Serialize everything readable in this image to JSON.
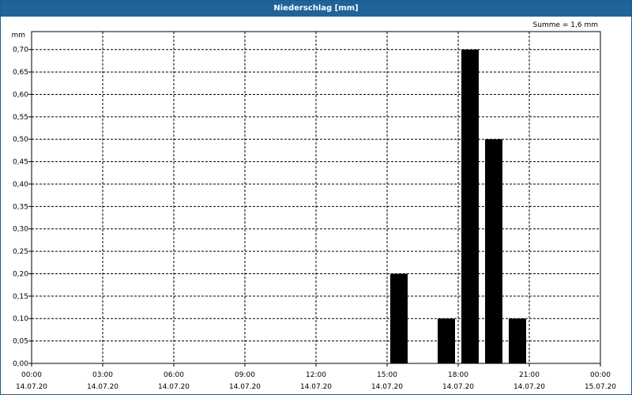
{
  "window": {
    "title": "Niederschlag [mm]"
  },
  "chart_data": {
    "type": "bar",
    "title": "Niederschlag [mm]",
    "annotation": "Summe = 1,6 mm",
    "ylabel": "mm",
    "xlabel": "",
    "ylim": [
      0,
      0.74
    ],
    "grid": true,
    "y_ticks": [
      "0,00",
      "0,05",
      "0,10",
      "0,15",
      "0,20",
      "0,25",
      "0,30",
      "0,35",
      "0,40",
      "0,45",
      "0,50",
      "0,55",
      "0,60",
      "0,65",
      "0,70"
    ],
    "x_ticks": [
      {
        "time": "00:00",
        "date": "14.07.20"
      },
      {
        "time": "03:00",
        "date": "14.07.20"
      },
      {
        "time": "06:00",
        "date": "14.07.20"
      },
      {
        "time": "09:00",
        "date": "14.07.20"
      },
      {
        "time": "12:00",
        "date": "14.07.20"
      },
      {
        "time": "15:00",
        "date": "14.07.20"
      },
      {
        "time": "18:00",
        "date": "14.07.20"
      },
      {
        "time": "21:00",
        "date": "14.07.20"
      },
      {
        "time": "00:00",
        "date": "15.07.20"
      }
    ],
    "bars": [
      {
        "start": "14.07.20 15:00",
        "end": "14.07.20 16:00",
        "value": 0.2
      },
      {
        "start": "14.07.20 17:00",
        "end": "14.07.20 18:00",
        "value": 0.1
      },
      {
        "start": "14.07.20 18:00",
        "end": "14.07.20 19:00",
        "value": 0.7
      },
      {
        "start": "14.07.20 19:00",
        "end": "14.07.20 20:00",
        "value": 0.5
      },
      {
        "start": "14.07.20 20:00",
        "end": "14.07.20 21:00",
        "value": 0.1
      }
    ],
    "bar_color": "#000000"
  }
}
